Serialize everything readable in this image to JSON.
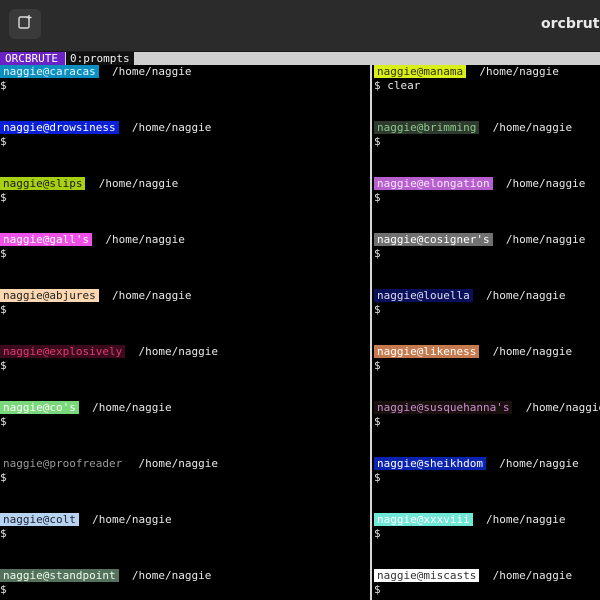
{
  "window": {
    "title": "orcbrute",
    "new_tab_icon": "new-tab-icon"
  },
  "statusbar": {
    "session": "ORCBRUTE",
    "window_label": "0:prompts",
    "session_color": "#6a22c6"
  },
  "left_pane": [
    {
      "host": "naggie@caracas",
      "path": "/home/naggie",
      "prompt": "$",
      "command": "",
      "bg": "#0b8fc0",
      "fg": "#e6f6ff"
    },
    {
      "host": "naggie@drowsiness",
      "path": "/home/naggie",
      "prompt": "$",
      "command": "",
      "bg": "#0a20d6",
      "fg": "#ffffff"
    },
    {
      "host": "naggie@slips",
      "path": "/home/naggie",
      "prompt": "$",
      "command": "",
      "bg": "#a8d012",
      "fg": "#1a1a1a"
    },
    {
      "host": "naggie@gall's",
      "path": "/home/naggie",
      "prompt": "$",
      "command": "",
      "bg": "#f04fe8",
      "fg": "#ffffff"
    },
    {
      "host": "naggie@abjures",
      "path": "/home/naggie",
      "prompt": "$",
      "command": "",
      "bg": "#fcd7b0",
      "fg": "#222222"
    },
    {
      "host": "naggie@explosively",
      "path": "/home/naggie",
      "prompt": "$",
      "command": "",
      "bg": "#3b0a1c",
      "fg": "#e03a6e"
    },
    {
      "host": "naggie@co's",
      "path": "/home/naggie",
      "prompt": "$",
      "command": "",
      "bg": "#79d87a",
      "fg": "#ffffff"
    },
    {
      "host": "naggie@proofreader",
      "path": "/home/naggie",
      "prompt": "$",
      "command": "",
      "bg": "#000000",
      "fg": "#9a9a9a"
    },
    {
      "host": "naggie@colt",
      "path": "/home/naggie",
      "prompt": "$",
      "command": "",
      "bg": "#b6d4f2",
      "fg": "#223"
    },
    {
      "host": "naggie@standpoint",
      "path": "/home/naggie",
      "prompt": "$",
      "command": "",
      "bg": "#56705e",
      "fg": "#e8ffe8"
    }
  ],
  "right_pane": [
    {
      "host": "naggie@manama",
      "path": "/home/naggie",
      "prompt": "$",
      "command": "clear",
      "bg": "#d8ef18",
      "fg": "#333300"
    },
    {
      "host": "naggie@brimming",
      "path": "/home/naggie",
      "prompt": "$",
      "command": "",
      "bg": "#2d3a2d",
      "fg": "#8bc78b"
    },
    {
      "host": "naggie@elongation",
      "path": "/home/naggie",
      "prompt": "$",
      "command": "",
      "bg": "#b85fd0",
      "fg": "#f6e8ff"
    },
    {
      "host": "naggie@cosigner's",
      "path": "/home/naggie",
      "prompt": "$",
      "command": "",
      "bg": "#707070",
      "fg": "#ffffff"
    },
    {
      "host": "naggie@louella",
      "path": "/home/naggie",
      "prompt": "$",
      "command": "",
      "bg": "#0a0f5a",
      "fg": "#dde"
    },
    {
      "host": "naggie@likeness",
      "path": "/home/naggie",
      "prompt": "$",
      "command": "",
      "bg": "#c77a4e",
      "fg": "#ffffff"
    },
    {
      "host": "naggie@susquehanna's",
      "path": "/home/naggie",
      "prompt": "$",
      "command": "",
      "bg": "#1a1010",
      "fg": "#c98fc9"
    },
    {
      "host": "naggie@sheikhdom",
      "path": "/home/naggie",
      "prompt": "$",
      "command": "",
      "bg": "#0a22b0",
      "fg": "#ffffff"
    },
    {
      "host": "naggie@xxxviii",
      "path": "/home/naggie",
      "prompt": "$",
      "command": "",
      "bg": "#6fe8d8",
      "fg": "#ffffff"
    },
    {
      "host": "naggie@miscasts",
      "path": "/home/naggie",
      "prompt": "$",
      "command": "",
      "bg": "#ffffff",
      "fg": "#333333"
    }
  ]
}
